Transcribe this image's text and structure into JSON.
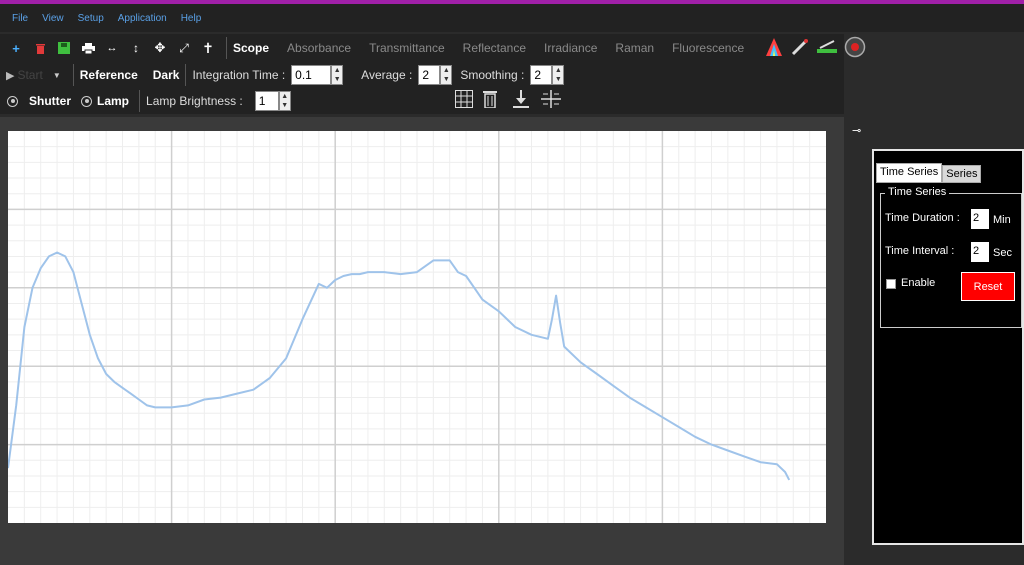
{
  "menu": [
    "File",
    "View",
    "Setup",
    "Application",
    "Help"
  ],
  "toolbar": {
    "modes": [
      "Scope",
      "Absorbance",
      "Transmittance",
      "Reflectance",
      "Irradiance",
      "Raman",
      "Fluorescence"
    ],
    "active_mode": "Scope"
  },
  "controls": {
    "start_label": "Start",
    "reference_label": "Reference",
    "dark_label": "Dark",
    "integration_time_label": "Integration Time :",
    "integration_time_value": "0.1",
    "average_label": "Average :",
    "average_value": "2",
    "smoothing_label": "Smoothing :",
    "smoothing_value": "2",
    "shutter_label": "Shutter",
    "lamp_label": "Lamp",
    "lamp_brightness_label": "Lamp Brightness :",
    "lamp_brightness_value": "1"
  },
  "panel": {
    "tabs": [
      "Time Series",
      "Series"
    ],
    "group_title": "Time Series",
    "time_duration_label": "Time Duration :",
    "time_duration_value": "2",
    "time_duration_unit": "Min",
    "time_interval_label": "Time Interval :",
    "time_interval_value": "2",
    "time_interval_unit": "Sec",
    "enable_label": "Enable",
    "reset_label": "Reset"
  },
  "colors": {
    "accent_bar": "#a020a8",
    "menu_text": "#5aa0e6",
    "spectrum_line": "#9fc3ea",
    "reset_button": "#ff0000"
  },
  "chart_data": {
    "type": "line",
    "xlim": [
      0,
      100
    ],
    "ylim": [
      0,
      100
    ],
    "grid": true,
    "series": [
      {
        "x": [
          0,
          1,
          2,
          3,
          4,
          5,
          6,
          7,
          8,
          9,
          10,
          11,
          12,
          13,
          14,
          15,
          16,
          17,
          18,
          20,
          22,
          24,
          26,
          28,
          30,
          32,
          34,
          36,
          38,
          39,
          40,
          41,
          42,
          43,
          44,
          45,
          46,
          48,
          50,
          52,
          54,
          55,
          56,
          57,
          58,
          60,
          62,
          64,
          66,
          66.5,
          67,
          67.5,
          68,
          70,
          72,
          74,
          76,
          78,
          80,
          82,
          84,
          86,
          88,
          90,
          92,
          94,
          95,
          95.5
        ],
        "y": [
          14,
          30,
          50,
          60,
          65,
          68,
          69,
          68,
          64,
          56,
          48,
          42,
          38,
          36,
          34.5,
          33,
          31.5,
          30,
          29.5,
          29.5,
          30,
          31.5,
          32,
          33,
          34,
          37,
          42,
          52,
          61,
          60,
          62,
          63,
          63.5,
          63.5,
          64,
          64,
          64,
          63.5,
          64,
          67,
          67,
          64,
          63,
          60,
          57,
          54,
          50,
          48,
          47,
          52,
          58,
          51,
          45,
          41,
          38,
          35,
          32,
          29.5,
          27,
          24.5,
          22,
          20,
          18.5,
          17,
          15.5,
          15,
          13,
          11
        ]
      }
    ]
  }
}
